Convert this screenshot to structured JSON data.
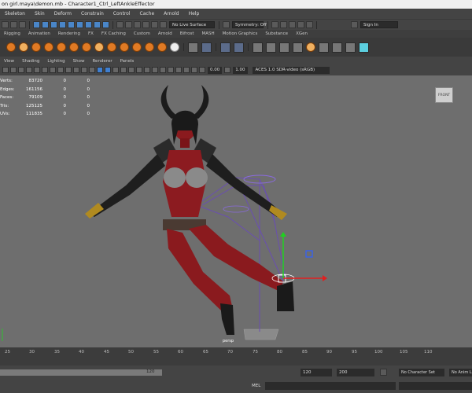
{
  "window": {
    "title": "on girl.maya\\demon.mb - Character1_Ctrl_LeftAnkleEffector"
  },
  "menubar": {
    "items": [
      "Skeleton",
      "Skin",
      "Deform",
      "Constrain",
      "Control",
      "Cache",
      "Arnold",
      "Help"
    ]
  },
  "statusline": {
    "live_surface": "No Live Surface",
    "symmetry": "Symmetry: Off",
    "signin": "Sign In"
  },
  "shelf": {
    "tabs": [
      "Rigging",
      "Animation",
      "Rendering",
      "FX",
      "FX Caching",
      "Custom",
      "Arnold",
      "Bifrost",
      "MASH",
      "Motion Graphics",
      "Substance",
      "XGen"
    ]
  },
  "panel": {
    "menu": [
      "View",
      "Shading",
      "Lighting",
      "Show",
      "Renderer",
      "Panels"
    ],
    "exposure": "0.00",
    "gamma": "1.00",
    "color_space": "ACES 1.0 SDR-video (sRGB)"
  },
  "hud": {
    "rows": [
      {
        "label": "Verts:",
        "v1": "83720",
        "v2": "0",
        "v3": "0"
      },
      {
        "label": "Edges:",
        "v1": "161156",
        "v2": "0",
        "v3": "0"
      },
      {
        "label": "Faces:",
        "v1": "79109",
        "v2": "0",
        "v3": "0"
      },
      {
        "label": "Tris:",
        "v1": "125125",
        "v2": "0",
        "v3": "0"
      },
      {
        "label": "UVs:",
        "v1": "111835",
        "v2": "0",
        "v3": "0"
      }
    ],
    "view_cube": "FRONT",
    "camera": "persp"
  },
  "timeline": {
    "ticks": [
      "25",
      "30",
      "35",
      "40",
      "45",
      "50",
      "55",
      "60",
      "65",
      "70",
      "75",
      "80",
      "85",
      "90",
      "95",
      "100",
      "105",
      "110"
    ],
    "range_end_inner": "120",
    "range_end": "120",
    "playback_end": "200",
    "character_set": "No Character Set",
    "anim_layer": "No Anim L"
  },
  "commandline": {
    "label": "MEL"
  },
  "colors": {
    "viewport_bg": "#6e6e6e",
    "body": "#8a1a1e",
    "armor": "#1e1e1e"
  }
}
